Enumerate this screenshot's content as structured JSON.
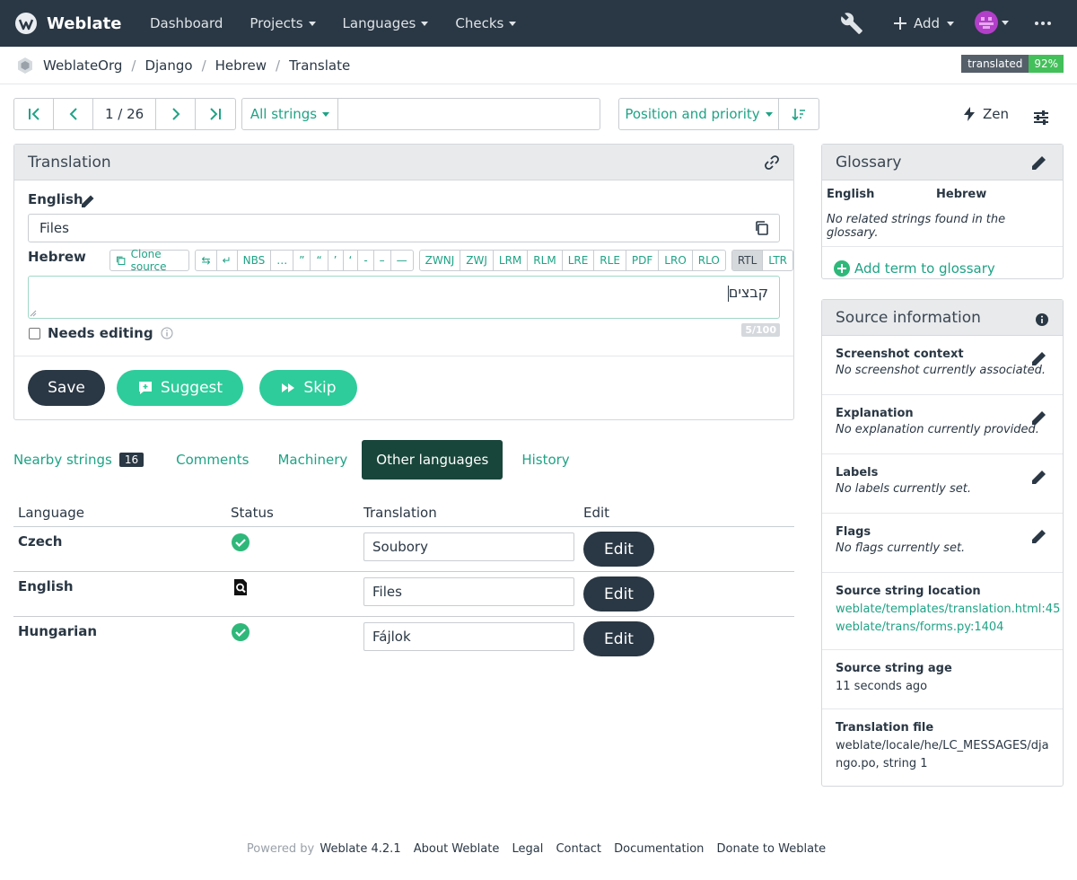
{
  "nav": {
    "brand": "Weblate",
    "items": [
      {
        "label": "Dashboard",
        "has_caret": false
      },
      {
        "label": "Projects",
        "has_caret": true
      },
      {
        "label": "Languages",
        "has_caret": true
      },
      {
        "label": "Checks",
        "has_caret": true
      }
    ],
    "add_label": "Add",
    "icons": [
      "wrench-icon",
      "plus-icon",
      "avatar",
      "kebab-icon"
    ]
  },
  "breadcrumb": {
    "items": [
      "WeblateOrg",
      "Django",
      "Hebrew",
      "Translate"
    ],
    "badge_label": "translated",
    "badge_value": "92%"
  },
  "toolbar": {
    "position": "1 / 26",
    "filter_label": "All strings",
    "search_value": "",
    "sort_label": "Position and priority",
    "zen_label": "Zen"
  },
  "translation": {
    "panel_title": "Translation",
    "source_lang": "English",
    "source_text": "Files",
    "target_lang": "Hebrew",
    "clone_label": "Clone source",
    "chars_group1": [
      "⇆",
      "↵",
      "NBS",
      "…",
      "”",
      "“",
      "’",
      "‘",
      "-",
      "–",
      "—"
    ],
    "chars_group2": [
      "ZWNJ",
      "ZWJ",
      "LRM",
      "RLM",
      "LRE",
      "RLE",
      "PDF",
      "LRO",
      "RLO"
    ],
    "dir_buttons": [
      "RTL",
      "LTR"
    ],
    "target_text": "קבצים",
    "needs_editing_label": "Needs editing",
    "counter": "5/100",
    "save_label": "Save",
    "suggest_label": "Suggest",
    "skip_label": "Skip"
  },
  "tabs": [
    {
      "label": "Nearby strings",
      "count": "16"
    },
    {
      "label": "Comments"
    },
    {
      "label": "Machinery"
    },
    {
      "label": "Other languages",
      "active": true
    },
    {
      "label": "History"
    }
  ],
  "other_languages": {
    "headers": [
      "Language",
      "Status",
      "Translation",
      "Edit"
    ],
    "rows": [
      {
        "language": "Czech",
        "status_icon": "check-circle-icon",
        "translation": "Soubory",
        "edit_label": "Edit"
      },
      {
        "language": "English",
        "status_icon": "source-icon",
        "translation": "Files",
        "edit_label": "Edit"
      },
      {
        "language": "Hungarian",
        "status_icon": "check-circle-icon",
        "translation": "Fájlok",
        "edit_label": "Edit"
      }
    ]
  },
  "glossary": {
    "title": "Glossary",
    "col_source": "English",
    "col_target": "Hebrew",
    "empty_text": "No related strings found in the glossary.",
    "add_label": "Add term to glossary"
  },
  "source_info": {
    "title": "Source information",
    "items": [
      {
        "title": "Screenshot context",
        "value": "No screenshot currently associated."
      },
      {
        "title": "Explanation",
        "value": "No explanation currently provided."
      },
      {
        "title": "Labels",
        "value": "No labels currently set."
      },
      {
        "title": "Flags",
        "value": "No flags currently set."
      }
    ],
    "location_title": "Source string location",
    "location_links": [
      "weblate/templates/translation.html:45",
      "weblate/trans/forms.py:1404"
    ],
    "age_title": "Source string age",
    "age_value": "11 seconds ago",
    "file_title": "Translation file",
    "file_value": "weblate/locale/he/LC_MESSAGES/django.po, string 1"
  },
  "footer": {
    "powered": "Powered by",
    "links": [
      "Weblate 4.2.1",
      "About Weblate",
      "Legal",
      "Contact",
      "Documentation",
      "Donate to Weblate"
    ]
  },
  "colors": {
    "navbar": "#2a3744",
    "accent": "#1fa385",
    "suggest": "#2ecc9a",
    "active_tab": "#19463a",
    "badge_green": "#43c05a"
  }
}
